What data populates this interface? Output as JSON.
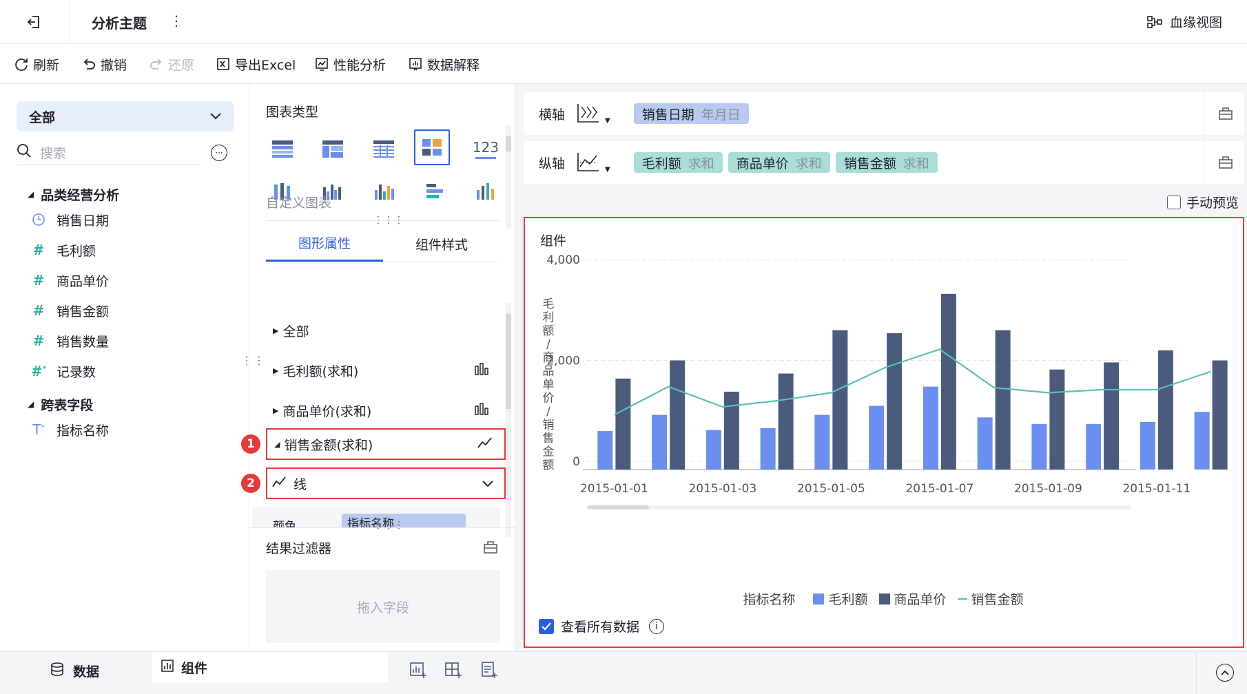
{
  "header": {
    "title": "分析主题",
    "lineage_label": "血缘视图"
  },
  "toolbar": {
    "refresh": "刷新",
    "undo": "撤销",
    "redo": "还原",
    "export": "导出Excel",
    "perf": "性能分析",
    "explain": "数据解释"
  },
  "left": {
    "dropdown": "全部",
    "search_placeholder": "搜索",
    "groups": [
      {
        "name": "品类经营分析",
        "fields": [
          {
            "icon": "clock-icon",
            "label": "销售日期"
          },
          {
            "icon": "hash-icon",
            "label": "毛利额"
          },
          {
            "icon": "hash-icon",
            "label": "商品单价"
          },
          {
            "icon": "hash-icon",
            "label": "销售金额"
          },
          {
            "icon": "hash-icon",
            "label": "销售数量"
          },
          {
            "icon": "hash-star-icon",
            "label": "记录数"
          }
        ]
      },
      {
        "name": "跨表字段",
        "fields": [
          {
            "icon": "text-star-icon",
            "label": "指标名称"
          }
        ]
      }
    ]
  },
  "mid": {
    "chart_type_title": "图表类型",
    "custom_chart": "自定义图表",
    "tabs": [
      "图形属性",
      "组件样式"
    ],
    "props": [
      "全部",
      "毛利额(求和)",
      "商品单价(求和)",
      "销售金额(求和)"
    ],
    "line_option": "线",
    "color_label": "颜色",
    "color_field": "指标名称",
    "badges": [
      "1",
      "2"
    ],
    "filter_title": "结果过滤器",
    "filter_drop": "拖入字段",
    "tpl_123": "123"
  },
  "right": {
    "x_label": "横轴",
    "y_label": "纵轴",
    "x_pill": {
      "name": "销售日期",
      "sub": "年月日"
    },
    "y_pills": [
      {
        "name": "毛利额",
        "sub": "求和"
      },
      {
        "name": "商品单价",
        "sub": "求和"
      },
      {
        "name": "销售金额",
        "sub": "求和"
      }
    ],
    "manual_preview": "手动预览",
    "widget_title": "组件",
    "view_all": "查看所有数据"
  },
  "bottom": {
    "data_tab": "数据",
    "widget_tab": "组件"
  },
  "colors": {
    "accent": "#2c5fe0",
    "bar1": "#6b8ff0",
    "bar2": "#4a5b7d",
    "line": "#5dbfb1",
    "red": "#e5393b"
  },
  "chart_data": {
    "type": "bar",
    "y_title": "毛利额/商品单价/销售金额",
    "y_ticks": [
      "4,000",
      "2,000",
      "0"
    ],
    "ylim": [
      0,
      4000
    ],
    "x_ticks": [
      "2015-01-01",
      "2015-01-03",
      "2015-01-05",
      "2015-01-07",
      "2015-01-09",
      "2015-01-11"
    ],
    "categories": [
      "2015-01-01",
      "2015-01-02",
      "2015-01-03",
      "2015-01-04",
      "2015-01-05",
      "2015-01-06",
      "2015-01-07",
      "2015-01-08",
      "2015-01-09",
      "2015-01-10",
      "2015-01-11",
      "2015-01-12"
    ],
    "legend_title": "指标名称",
    "series": [
      {
        "name": "毛利额",
        "type": "bar",
        "values": [
          600,
          920,
          620,
          660,
          920,
          1100,
          1480,
          870,
          740,
          740,
          780,
          980
        ]
      },
      {
        "name": "商品单价",
        "type": "bar",
        "values": [
          1640,
          2000,
          1380,
          1740,
          2600,
          2540,
          3320,
          2600,
          1820,
          1960,
          2200,
          2000
        ]
      },
      {
        "name": "销售金额",
        "type": "line",
        "values": [
          920,
          1480,
          1080,
          1200,
          1360,
          1860,
          2220,
          1460,
          1360,
          1420,
          1420,
          1780
        ]
      }
    ]
  }
}
